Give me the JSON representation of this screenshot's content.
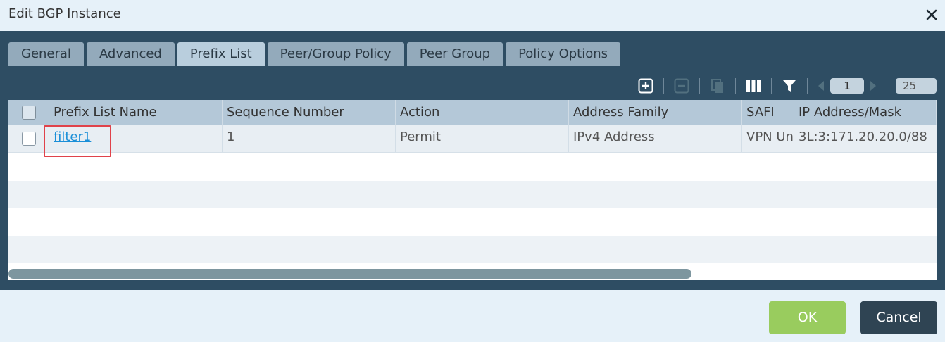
{
  "dialog": {
    "title": "Edit BGP Instance"
  },
  "tabs": [
    {
      "label": "General",
      "active": false
    },
    {
      "label": "Advanced",
      "active": false
    },
    {
      "label": "Prefix List",
      "active": true
    },
    {
      "label": "Peer/Group Policy",
      "active": false
    },
    {
      "label": "Peer Group",
      "active": false
    },
    {
      "label": "Policy Options",
      "active": false
    }
  ],
  "toolbar": {
    "icons": [
      "add-icon",
      "remove-icon",
      "clone-icon",
      "columns-icon",
      "filter-icon",
      "prev-page-icon",
      "next-page-icon"
    ],
    "page_number": "1",
    "page_size": "25"
  },
  "grid": {
    "columns": [
      "Prefix List Name",
      "Sequence Number",
      "Action",
      "Address Family",
      "SAFI",
      "IP Address/Mask"
    ],
    "rows": [
      {
        "prefix_list_name": "filter1",
        "sequence_number": "1",
        "action": "Permit",
        "address_family": "IPv4 Address",
        "safi": "VPN Un",
        "ip_address_mask": "3L:3:171.20.20.0/88"
      }
    ]
  },
  "footer": {
    "ok_label": "OK",
    "cancel_label": "Cancel"
  },
  "colors": {
    "panel": "#2e4d63",
    "ok": "#99cc5e",
    "cancel": "#2f4453",
    "highlight": "#e0424a",
    "link": "#1a8fd8"
  }
}
